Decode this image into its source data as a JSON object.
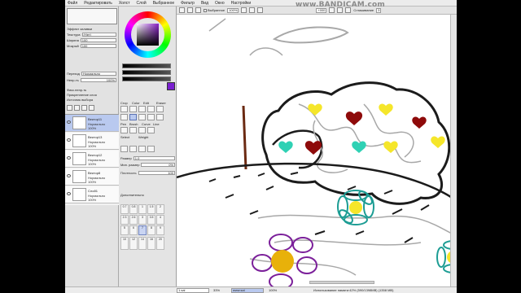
{
  "menu": [
    "Файл",
    "Редактировать",
    "Холст",
    "Слой",
    "Выбранное",
    "Фильтр",
    "Вид",
    "Окно",
    "Настройки"
  ],
  "toolbar": {
    "zoom": "100%",
    "antialias_label": "Выбранное",
    "rotation": "+000",
    "smoothing_label": "Сглаживание",
    "smoothing_value": "3"
  },
  "watermark": "www.BANDICAM.com",
  "left_panel": {
    "fill_label": "Эффект заливки",
    "texture_label": "Текстура",
    "texture_value": "(Нет)",
    "width_label": "Ширина",
    "width_value": "100",
    "strength_label": "Мокрый",
    "strength_value": "100",
    "blend_label": "Переход",
    "blend_value": "Нормально",
    "opacity_label": "Непр-ть",
    "opacity_value": "100%",
    "pixel_lock": "Фикс.непр-ть",
    "clip_group": "Прикрепление слоя",
    "selection_source": "Источник выбора"
  },
  "layers": [
    {
      "name": "Вектор11",
      "mode": "Нормально",
      "pct": "100%",
      "selected": true
    },
    {
      "name": "Вектор13",
      "mode": "Нормально",
      "pct": "100%",
      "selected": false
    },
    {
      "name": "Вектор12",
      "mode": "Нормально",
      "pct": "100%",
      "selected": false
    },
    {
      "name": "Вектор8",
      "mode": "Нормально",
      "pct": "100%",
      "selected": false
    },
    {
      "name": "Слой1",
      "mode": "Нормально",
      "pct": "100%",
      "selected": false
    }
  ],
  "tools": {
    "row_labels": [
      "Crop",
      "Color",
      "Edit",
      "Eraser"
    ],
    "pen_label": "Pen",
    "brush_label": "Brush",
    "curve_label": "Curve",
    "line_label": "Line",
    "select_label": "Select",
    "weight_label": "Weight",
    "size_label": "Размер",
    "size_value": "1.0",
    "min_size_label": "Мин. размер",
    "min_size_value": "0%",
    "density_label": "Плотность",
    "density_value": "100",
    "advanced_label": "Дополнительно",
    "sizes_row1": [
      "0.7",
      "0.8",
      "1",
      "1.5",
      "2"
    ],
    "sizes_row2": [
      "2.3",
      "2.6",
      "3",
      "3.5",
      "4"
    ],
    "sizes_row3": [
      "5",
      "6",
      "7",
      "8",
      "9"
    ],
    "sizes_row4": [
      "10",
      "12",
      "14",
      "16",
      "20"
    ]
  },
  "status": {
    "file": "1.sai",
    "file_zoom": "33%",
    "doc": "www.sai",
    "doc_zoom": "100%",
    "memory": "Использование памяти:42% (590/1398MB) (1358 MB)"
  },
  "colors": {
    "foreground": "#7a1fd0",
    "selected_layer": "#b9c9ef",
    "gray_ink": "#a8a8a8",
    "heart_red": "#8e0a0a",
    "heart_yellow": "#f5e62a",
    "heart_teal": "#2fd1b4",
    "flower_teal": "#1d9d94",
    "flower_purple": "#7b1f9a",
    "flower_center": "#e8b10a"
  }
}
